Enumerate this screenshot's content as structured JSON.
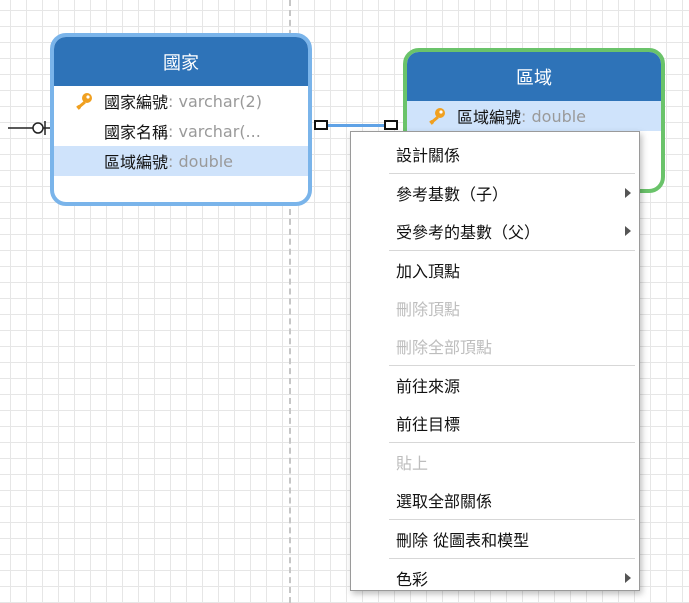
{
  "canvas": {
    "grid": true
  },
  "entities": {
    "country": {
      "title": "國家",
      "attributes": [
        {
          "name": "國家編號",
          "type": ": varchar(2)",
          "primary_key": true
        },
        {
          "name": "國家名稱",
          "type": ": varchar(...",
          "primary_key": false
        },
        {
          "name": "區域編號",
          "type": ": double",
          "primary_key": false,
          "selected": true
        }
      ]
    },
    "region": {
      "title": "區域",
      "attributes": [
        {
          "name": "區域編號",
          "type": ": double",
          "primary_key": true,
          "selected": true
        }
      ]
    }
  },
  "context_menu": {
    "items": [
      {
        "label": "設計關係",
        "enabled": true,
        "submenu": false
      },
      {
        "label": "參考基數（子）",
        "enabled": true,
        "submenu": true
      },
      {
        "label": "受參考的基數（父）",
        "enabled": true,
        "submenu": true
      },
      {
        "label": "加入頂點",
        "enabled": true,
        "submenu": false
      },
      {
        "label": "刪除頂點",
        "enabled": false,
        "submenu": false
      },
      {
        "label": "刪除全部頂點",
        "enabled": false,
        "submenu": false
      },
      {
        "label": "前往來源",
        "enabled": true,
        "submenu": false
      },
      {
        "label": "前往目標",
        "enabled": true,
        "submenu": false
      },
      {
        "label": "貼上",
        "enabled": false,
        "submenu": false
      },
      {
        "label": "選取全部關係",
        "enabled": true,
        "submenu": false
      },
      {
        "label": "刪除 從圖表和模型",
        "enabled": true,
        "submenu": false
      },
      {
        "label": "色彩",
        "enabled": true,
        "submenu": true
      }
    ]
  },
  "colors": {
    "entity_header": "#2e73b8",
    "country_border": "#7ab4ea",
    "region_border": "#6ac36a",
    "selected_row": "#cfe3fb",
    "connector": "#5fa2e6",
    "key_icon": "#f0a020"
  }
}
